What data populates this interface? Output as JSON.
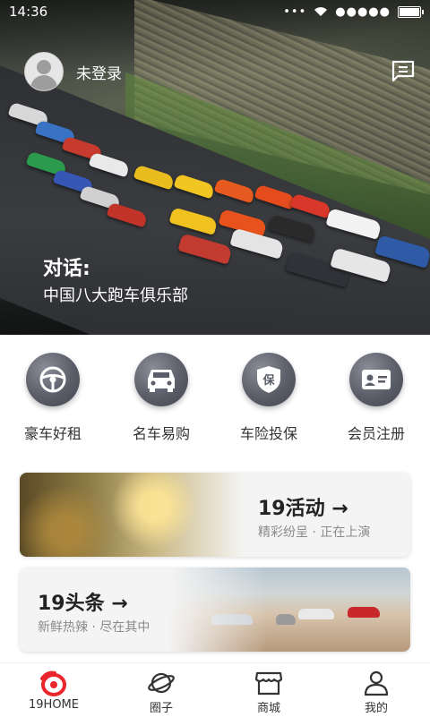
{
  "status_bar": {
    "time": "14:36",
    "signal": "●●●●●"
  },
  "hero": {
    "user_name": "未登录",
    "title_line1": "对话:",
    "title_line2": "中国八大跑车俱乐部"
  },
  "quick_actions": [
    {
      "label": "豪车好租",
      "icon": "steering-wheel-icon"
    },
    {
      "label": "名车易购",
      "icon": "car-icon"
    },
    {
      "label": "车险投保",
      "icon": "insurance-shield-icon"
    },
    {
      "label": "会员注册",
      "icon": "member-card-icon"
    }
  ],
  "cards": {
    "activity": {
      "title": "19活动 →",
      "subtitle": "精彩纷呈 · 正在上演"
    },
    "headlines": {
      "title": "19头条 →",
      "subtitle": "新鲜热辣 · 尽在其中"
    }
  },
  "tabs": [
    {
      "label": "19HOME",
      "icon": "home-logo-icon",
      "active": true
    },
    {
      "label": "圈子",
      "icon": "planet-icon"
    },
    {
      "label": "商城",
      "icon": "store-icon"
    },
    {
      "label": "我的",
      "icon": "profile-icon"
    }
  ],
  "colors": {
    "accent": "#e8262b",
    "icon_bg": "#5b5e69"
  }
}
